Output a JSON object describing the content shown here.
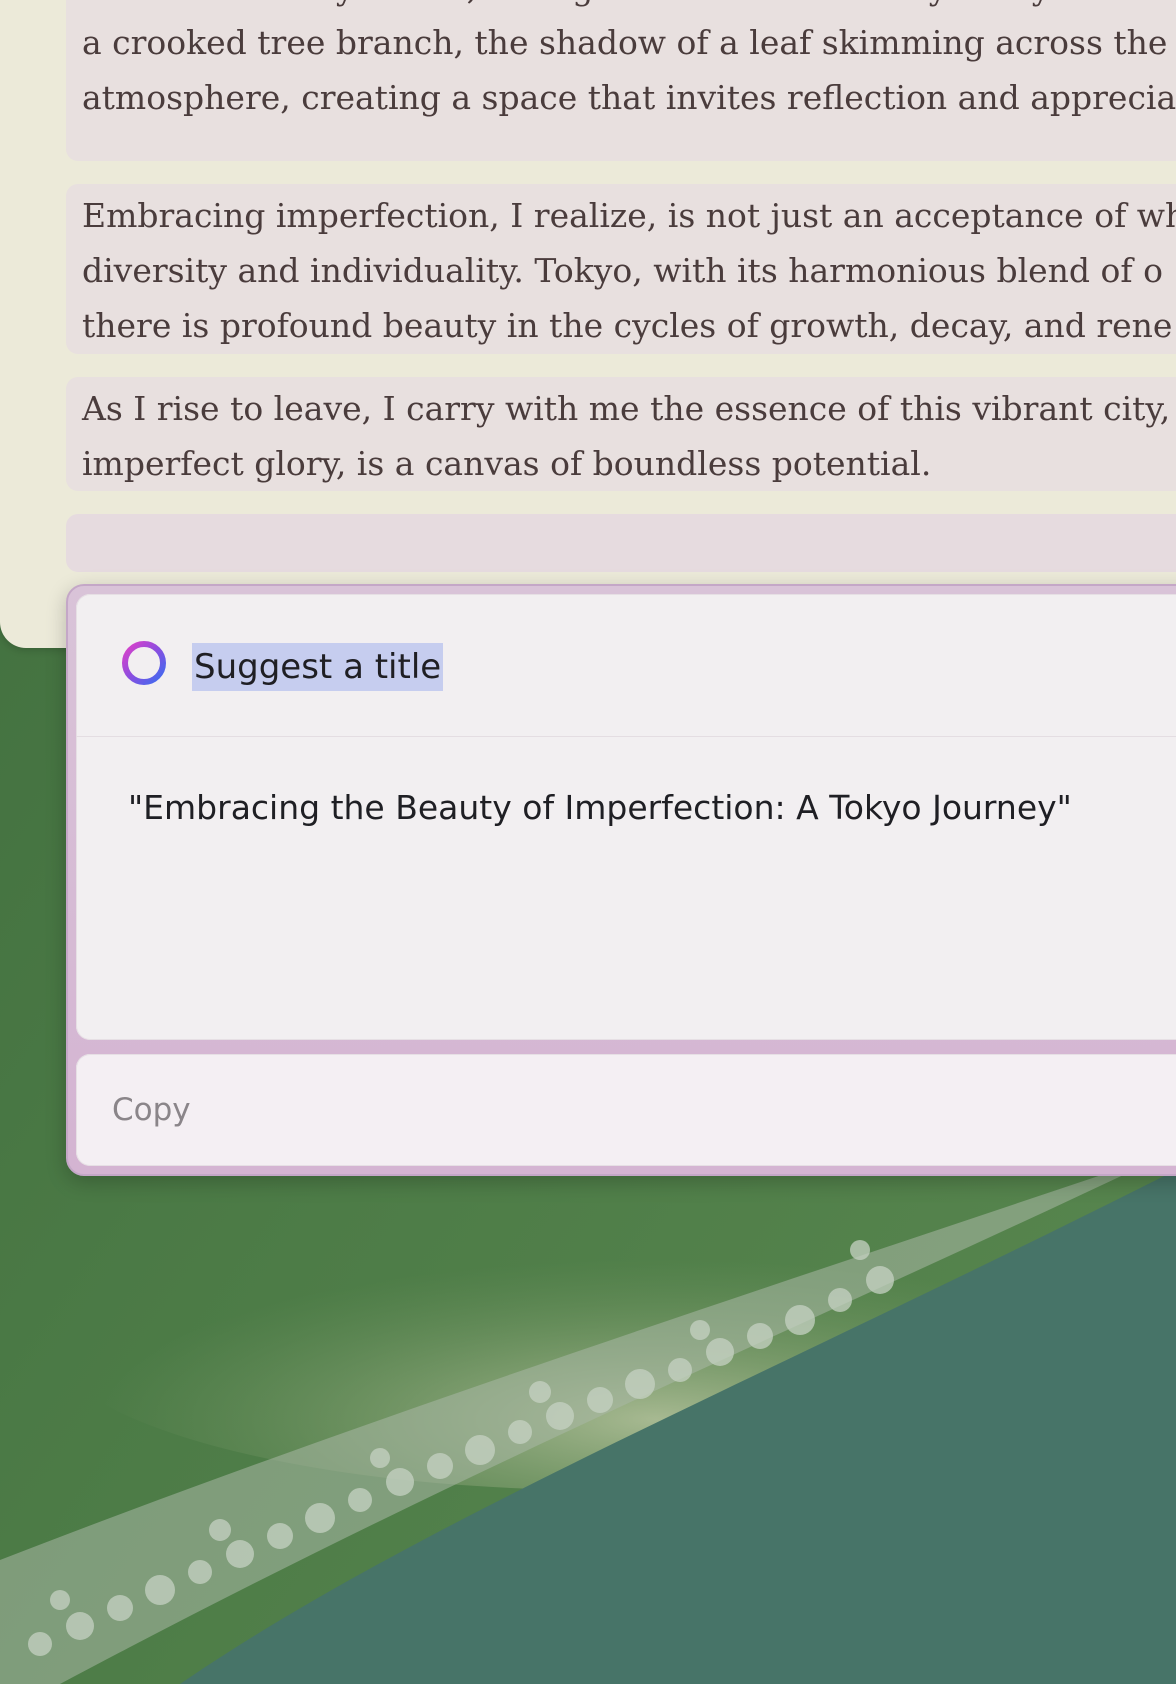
{
  "document": {
    "paragraphs": [
      {
        "lines": [
          "I sit on a nearby bench, taking in the serene beauty of my surrou",
          "a crooked tree branch, the shadow of a leaf skimming across the",
          "atmosphere, creating a space that invites reflection and apprecia"
        ]
      },
      {
        "lines": [
          "Embracing imperfection, I realize, is not just an acceptance of wh",
          "diversity and individuality. Tokyo, with its harmonious blend of o",
          "there is profound beauty in the cycles of growth, decay, and rene"
        ]
      },
      {
        "lines": [
          "As I rise to leave, I carry with me the essence of this vibrant city,",
          "imperfect glory, is a canvas of boundless potential."
        ]
      }
    ]
  },
  "writing_tools": {
    "prompt": "Suggest a title",
    "result": "\"Embracing the Beauty of Imperfection: A Tokyo Journey\"",
    "copy_label": "Copy"
  },
  "colors": {
    "ring_gradient_start": "#e040c8",
    "ring_gradient_end": "#3a6cf0",
    "highlight": "#c6cdef",
    "wallpaper_green": "#4a7a4a",
    "wallpaper_teal": "#477468"
  },
  "icons": {
    "prompt_icon": "apple-intelligence-ring-icon"
  }
}
